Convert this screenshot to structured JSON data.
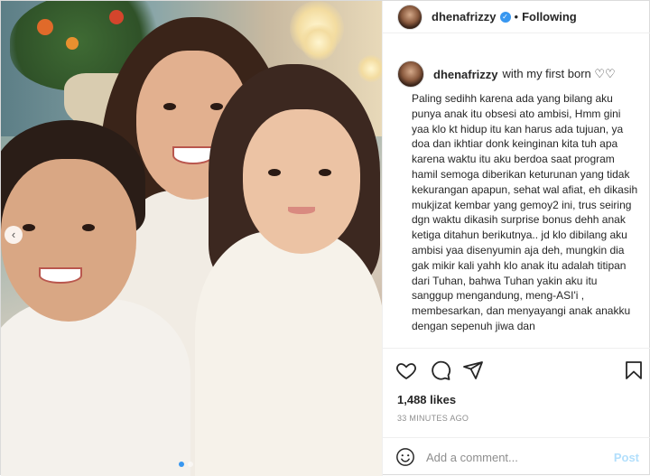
{
  "post": {
    "username": "dhenafrizzy",
    "follow_status": "Following",
    "separator": "•",
    "caption_with": "with my first born ♡♡",
    "caption_text": "Paling sedihh karena ada yang bilang aku punya anak itu obsesi ato ambisi, Hmm gini yaa klo kt hidup itu kan harus ada tujuan, ya doa dan ikhtiar donk keinginan kita tuh apa karena waktu itu aku berdoa saat program hamil semoga diberikan keturunan yang tidak kekurangan apapun, sehat wal afiat, eh dikasih mukjizat kembar yang gemoy2 ini, trus seiring dgn waktu dikasih surprise bonus dehh anak ketiga ditahun berikutnya.. jd klo dibilang aku ambisi yaa disenyumin aja deh, mungkin dia gak mikir kali yahh klo anak itu adalah titipan dari Tuhan, bahwa Tuhan yakin aku itu sanggup mengandung, meng-ASI'i , membesarkan, dan menyayangi anak anakku dengan sepenuh jiwa dan",
    "likes": "1,488 likes",
    "timestamp": "33 MINUTES AGO"
  },
  "comment": {
    "placeholder": "Add a comment...",
    "post_label": "Post"
  },
  "carousel": {
    "prev_label": "‹",
    "slide_count": 2,
    "active_slide": 1
  },
  "icons": {
    "verified": "verified-badge-icon",
    "like": "heart-icon",
    "comment": "comment-icon",
    "share": "paper-plane-icon",
    "save": "bookmark-icon",
    "emoji": "smiley-icon"
  },
  "colors": {
    "accent": "#3897f0",
    "text": "#262626",
    "muted": "#8e8e8e",
    "post_disabled": "#b2dffc"
  }
}
